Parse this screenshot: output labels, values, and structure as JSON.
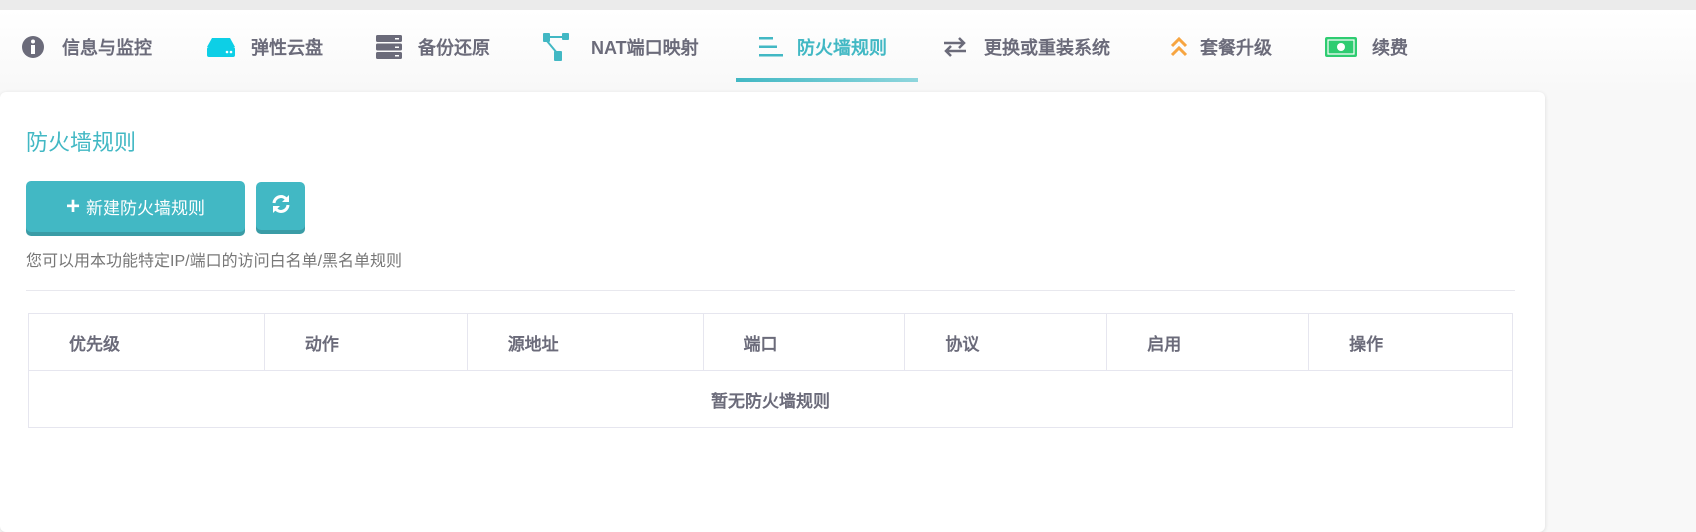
{
  "tabs": [
    {
      "label": "信息与监控",
      "icon": "info-icon"
    },
    {
      "label": "弹性云盘",
      "icon": "disk-icon"
    },
    {
      "label": "备份还原",
      "icon": "server-icon"
    },
    {
      "label": "NAT端口映射",
      "icon": "network-icon"
    },
    {
      "label": "防火墙规则",
      "icon": "list-icon",
      "active": true
    },
    {
      "label": "更换或重装系统",
      "icon": "exchange-icon"
    },
    {
      "label": "套餐升级",
      "icon": "upgrade-icon"
    },
    {
      "label": "续费",
      "icon": "money-icon"
    }
  ],
  "colors": {
    "accent": "#42b8c4",
    "disk": "#0dcfe6",
    "upgrade": "#f7a541",
    "money": "#2ecc71"
  },
  "page": {
    "title": "防火墙规则",
    "new_button": "新建防火墙规则",
    "hint": "您可以用本功能特定IP/端口的访问白名单/黑名单规则"
  },
  "table": {
    "headers": [
      "优先级",
      "动作",
      "源地址",
      "端口",
      "协议",
      "启用",
      "操作"
    ],
    "empty": "暂无防火墙规则"
  }
}
